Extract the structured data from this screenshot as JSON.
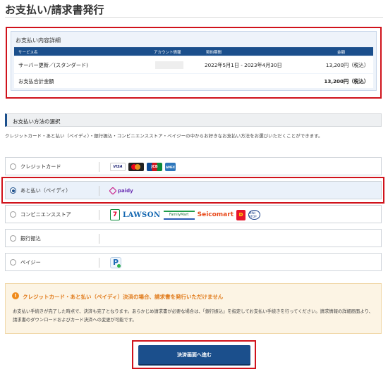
{
  "page": {
    "title": "お支払い/請求書発行"
  },
  "detail": {
    "heading": "お支払い内容詳細",
    "columns": [
      "サービス名",
      "アカウント情報",
      "契約期間",
      "金額"
    ],
    "rows": [
      {
        "service": "サーバー更新／(スタンダード)",
        "account": "",
        "period": "2022年5月1日 - 2023年4月30日",
        "amount": "13,200円（税込）"
      }
    ],
    "total_label": "お支払合計金額",
    "total_amount": "13,200円（税込）"
  },
  "method": {
    "heading": "お支払い方法の選択",
    "description": "クレジットカード・あと払い（ペイディ）・銀行振込・コンビニエンスストア・ペイジーの中からお好きなお支払い方法をお選びいただくことができます。",
    "options": [
      {
        "label": "クレジットカード",
        "selected": false,
        "logos": [
          "visa-logo",
          "mastercard-logo",
          "jcb-logo",
          "amex-logo"
        ]
      },
      {
        "label": "あと払い（ペイディ）",
        "selected": true,
        "logos": [
          "paidy-logo"
        ]
      },
      {
        "label": "コンビニエンスストア",
        "selected": false,
        "logos": [
          "seven-eleven-logo",
          "lawson-logo",
          "familymart-logo",
          "seicomart-logo",
          "daily-yamazaki-logo",
          "ministop-logo"
        ]
      },
      {
        "label": "銀行振込",
        "selected": false,
        "logos": []
      },
      {
        "label": "ペイジー",
        "selected": false,
        "logos": [
          "payeasy-logo"
        ]
      }
    ],
    "logo_text": {
      "visa": "VISA",
      "jcb": "JCB",
      "amex": "AMEX",
      "paidy": "paidy",
      "seven": "7",
      "lawson": "LAWSON",
      "familymart": "FamilyMart",
      "seicomart": "Seicomart",
      "daily": "D",
      "ministop": "MINI STOP"
    }
  },
  "notice": {
    "icon": "warning-icon",
    "icon_char": "!",
    "title": "クレジットカード・あと払い（ペイディ）決済の場合、請求書を発行いただけません",
    "body": "お支払い手続きが完了した時点で、決済も完了となります。あらかじめ請求書が必要な場合は、「銀行振込」を指定してお支払い手続きを行ってください。請求情報の詳細画面より、請求書のダウンロードおよびカード決済への変更が可能です。"
  },
  "submit": {
    "label": "決済画面へ進む"
  },
  "colors": {
    "accent": "#1b4f8c",
    "highlight": "#d0121b",
    "warning": "#e07a1a"
  }
}
